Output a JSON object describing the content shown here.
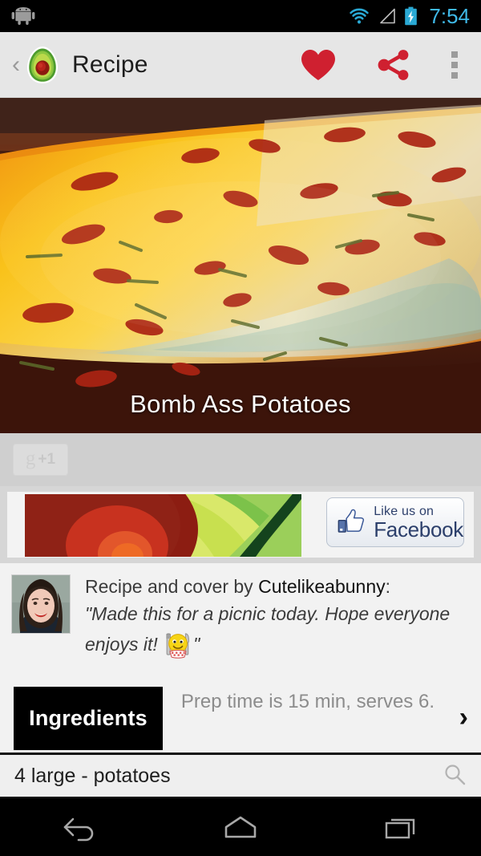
{
  "statusbar": {
    "robot_icon": "android-robot-icon",
    "wifi_icon": "wifi-icon",
    "signal_icon": "cell-signal-icon",
    "battery_icon": "battery-charging-icon",
    "clock": "7:54",
    "accent_color": "#3fb9e8"
  },
  "actionbar": {
    "back_label": "‹",
    "logo_icon": "avocado-logo-icon",
    "title": "Recipe",
    "favorite_icon": "heart-icon",
    "share_icon": "share-icon",
    "overflow_icon": "overflow-menu-icon",
    "accent_red": "#d0212f"
  },
  "hero": {
    "photo_alt": "baked cheesy potatoes casserole",
    "caption": "Bomb Ass Potatoes"
  },
  "social": {
    "gplus_label": "+1",
    "gplus_glyph": "g",
    "gplus_icon": "google-plus-one-button"
  },
  "ad": {
    "art_icon": "avocado-slice-banner-art",
    "facebook_line1": "Like us on",
    "facebook_line2": "Facebook",
    "facebook_icon": "thumbs-up-icon",
    "facebook_blue": "#3b5998"
  },
  "author": {
    "avatar_icon": "user-avatar",
    "credit_prefix": "Recipe and cover by ",
    "username": "Cutelikeabunny",
    "credit_suffix": ":",
    "quote_part1": "\"Made this for a picnic today.  Hope everyone enjoys it! ",
    "emoji_icon": "smiley-eating-emoji",
    "quote_part2": "\""
  },
  "tabs": {
    "ingredients_label": "Ingredients",
    "meta_text": "Prep time is 15 min, serves 6.",
    "chevron_icon": "chevron-right-icon",
    "chevron_label": "›"
  },
  "ingredients": [
    {
      "text": "4 large - potatoes",
      "search_icon": "search-icon"
    }
  ],
  "navbar": {
    "back_icon": "nav-back-icon",
    "home_icon": "nav-home-icon",
    "recents_icon": "nav-recents-icon"
  }
}
